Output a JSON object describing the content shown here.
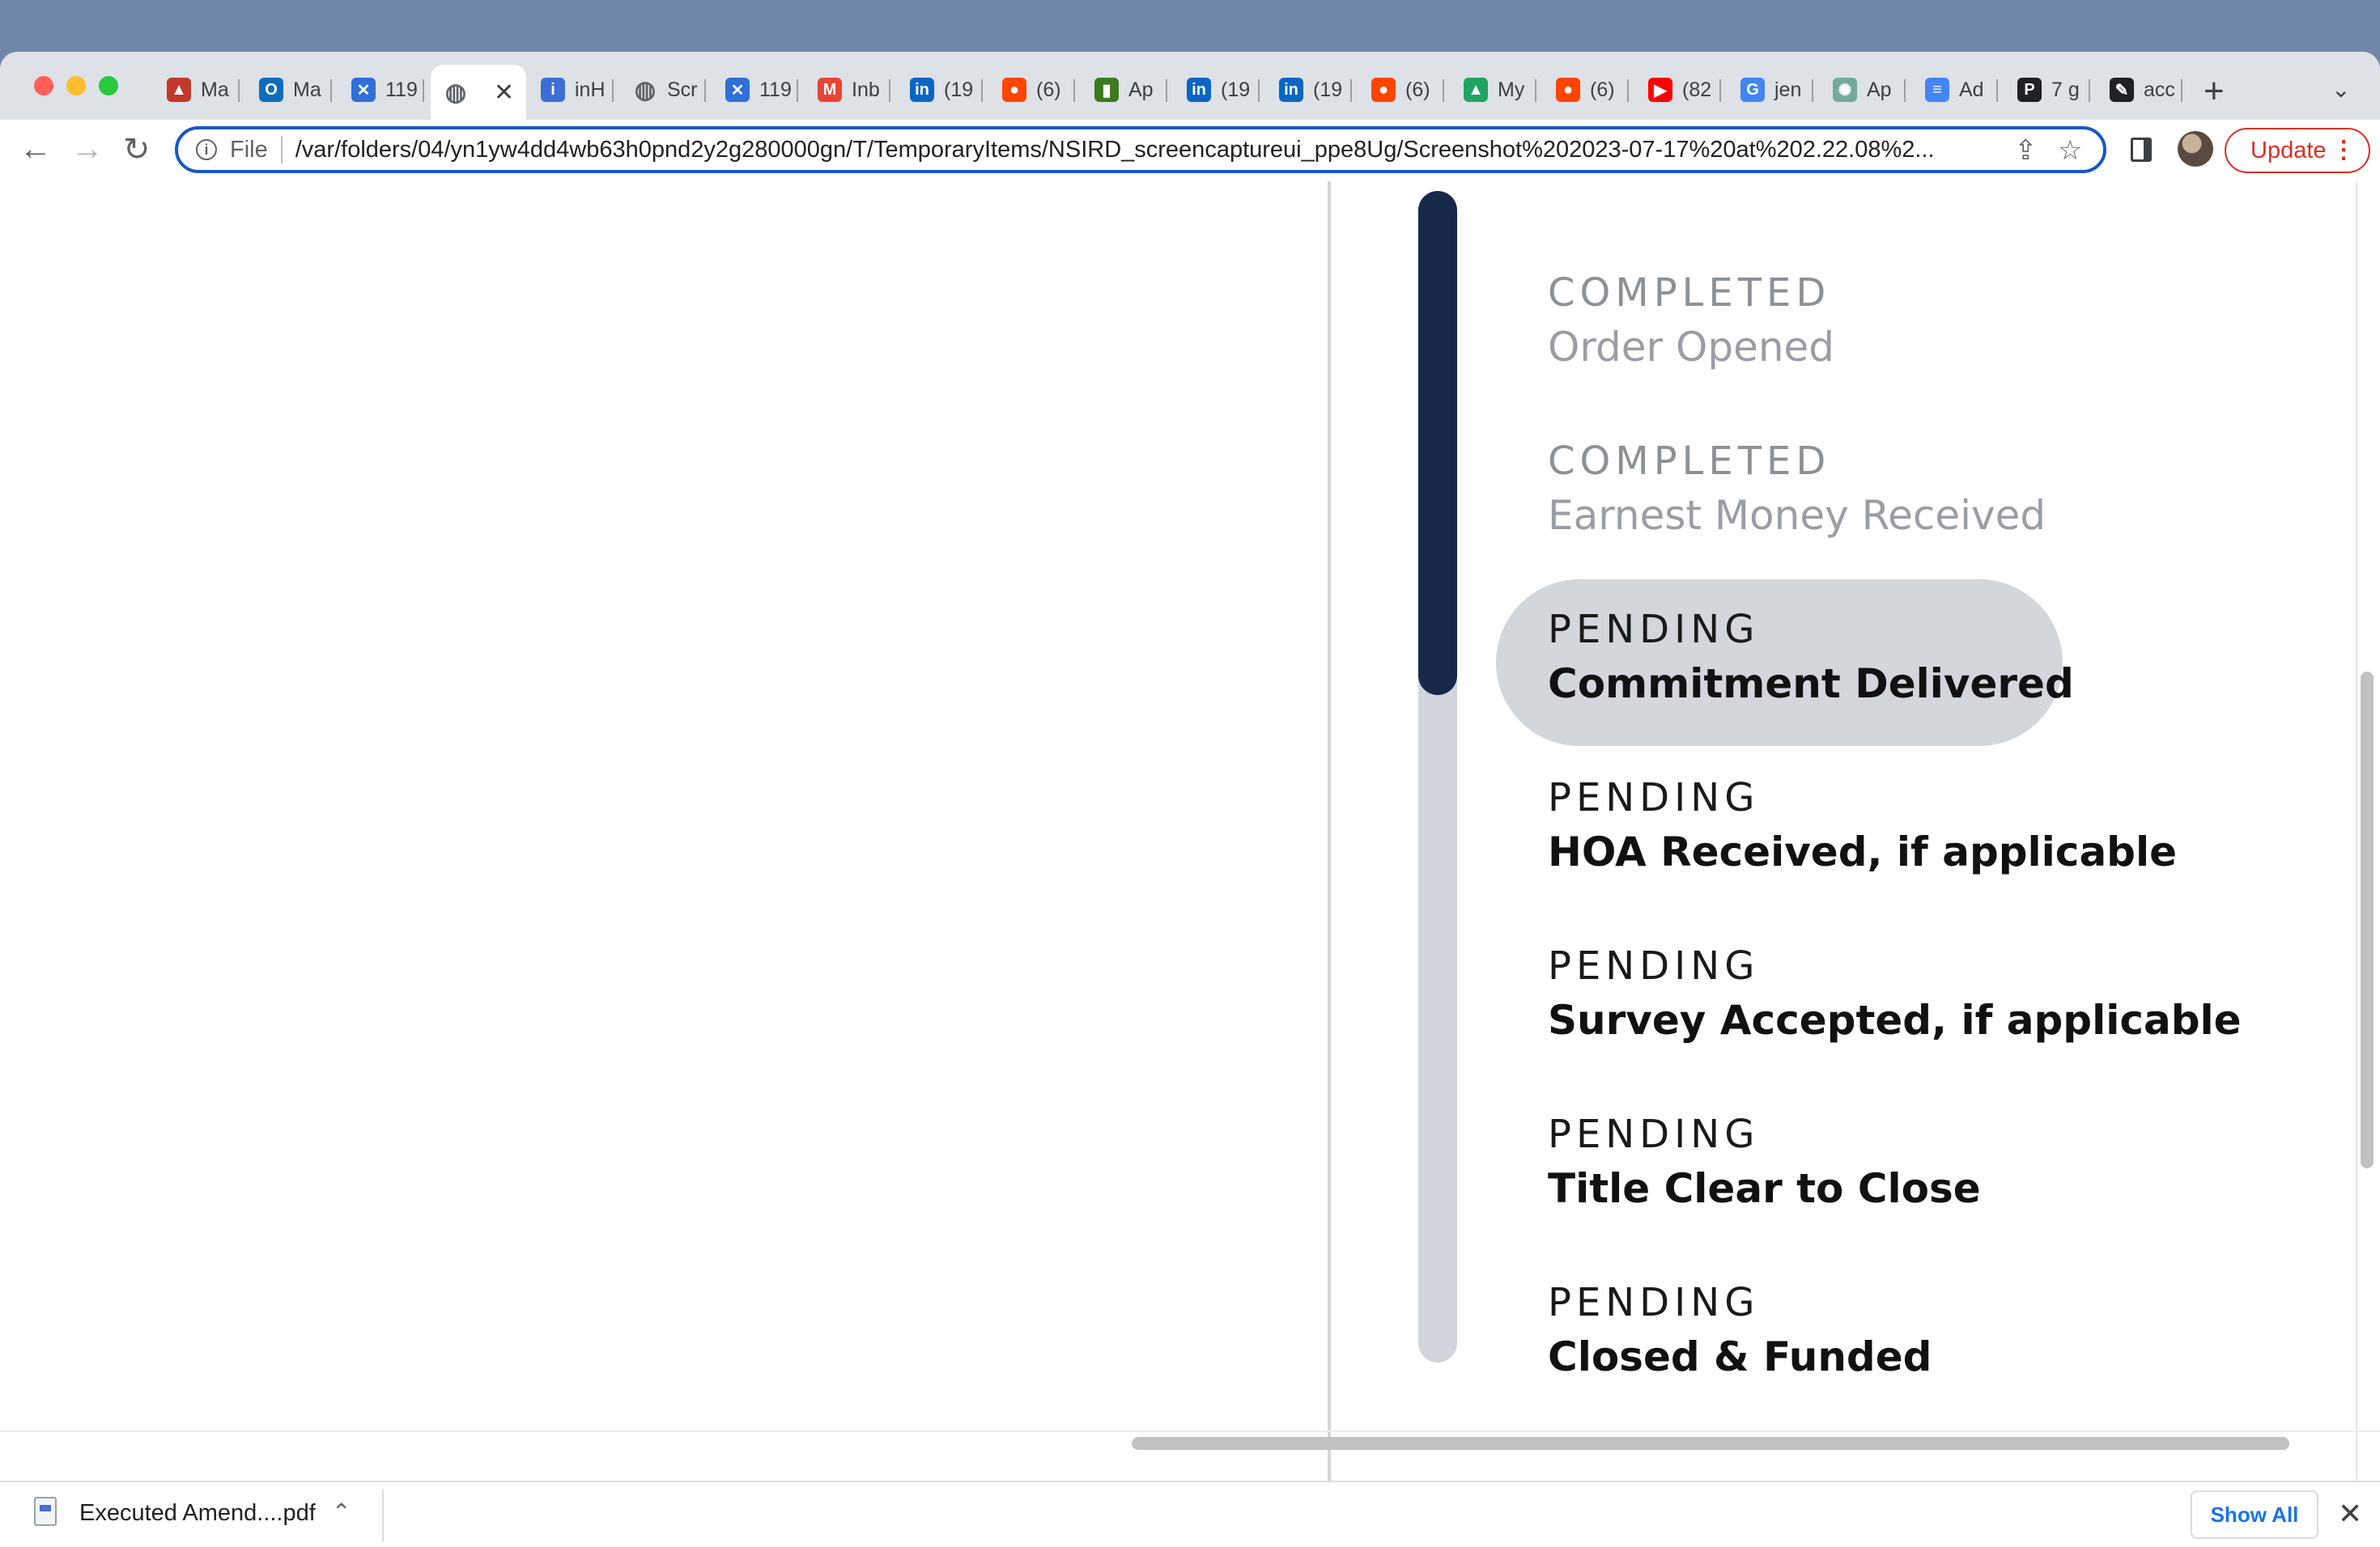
{
  "browser": {
    "tabs": [
      {
        "label": "Ma",
        "icon": "stack-icon",
        "color": "#c0392b",
        "glyph": "▲"
      },
      {
        "label": "Ma",
        "icon": "outlook-icon",
        "color": "#0f6cbd",
        "glyph": "O"
      },
      {
        "label": "119",
        "icon": "jira-icon",
        "color": "#2f6fd6",
        "glyph": "✕"
      },
      {
        "label": "",
        "icon": "globe-icon",
        "color": "#5f6368",
        "glyph": "◍",
        "active": true
      },
      {
        "label": "inH",
        "icon": "figure-icon",
        "color": "#3b6fd4",
        "glyph": "i"
      },
      {
        "label": "Scr",
        "icon": "globe-icon",
        "color": "#5f6368",
        "glyph": "◍"
      },
      {
        "label": "119",
        "icon": "jira-icon",
        "color": "#2f6fd6",
        "glyph": "✕"
      },
      {
        "label": "Inb",
        "icon": "gmail-icon",
        "color": "#ea4335",
        "glyph": "M"
      },
      {
        "label": "(19",
        "icon": "linkedin-icon",
        "color": "#0a66c2",
        "glyph": "in"
      },
      {
        "label": "(6)",
        "icon": "reddit-icon",
        "color": "#ff4500",
        "glyph": "●"
      },
      {
        "label": "Ap",
        "icon": "android-icon",
        "color": "#3c7a1e",
        "glyph": "▮"
      },
      {
        "label": "(19",
        "icon": "linkedin-icon",
        "color": "#0a66c2",
        "glyph": "in"
      },
      {
        "label": "(19",
        "icon": "linkedin-icon",
        "color": "#0a66c2",
        "glyph": "in"
      },
      {
        "label": "(6)",
        "icon": "reddit-icon",
        "color": "#ff4500",
        "glyph": "●"
      },
      {
        "label": "My",
        "icon": "drive-icon",
        "color": "#1fa463",
        "glyph": "▲"
      },
      {
        "label": "(6)",
        "icon": "reddit-icon",
        "color": "#ff4500",
        "glyph": "●"
      },
      {
        "label": "(82",
        "icon": "youtube-icon",
        "color": "#ff0000",
        "glyph": "▶"
      },
      {
        "label": "jen",
        "icon": "google-icon",
        "color": "#4285f4",
        "glyph": "G"
      },
      {
        "label": "Ap",
        "icon": "chatgpt-icon",
        "color": "#74aa9c",
        "glyph": "✺"
      },
      {
        "label": "Ad",
        "icon": "docs-icon",
        "color": "#4285f4",
        "glyph": "≡"
      },
      {
        "label": "7 g",
        "icon": "p-icon",
        "color": "#202124",
        "glyph": "P"
      },
      {
        "label": "acc",
        "icon": "pen-icon",
        "color": "#202124",
        "glyph": "✎"
      }
    ],
    "close_glyph": "✕",
    "new_tab_glyph": "+",
    "tab_menu_glyph": "⌄",
    "nav": {
      "back": "←",
      "forward": "→",
      "reload": "↻"
    },
    "address": {
      "scheme": "File",
      "url": "/var/folders/04/yn1yw4dd4wb63h0pnd2y2g280000gn/T/TemporaryItems/NSIRD_screencaptureui_ppe8Ug/Screenshot%202023-07-17%20at%202.22.08%2..."
    },
    "share_glyph": "⇪",
    "star_glyph": "☆",
    "update_label": "Update",
    "more_glyph": "⋮"
  },
  "timeline": {
    "progress_fraction": 0.43,
    "steps": [
      {
        "status": "COMPLETED",
        "title": "Order Opened",
        "state": "completed"
      },
      {
        "status": "COMPLETED",
        "title": "Earnest Money Received",
        "state": "completed"
      },
      {
        "status": "PENDING",
        "title": "Commitment Delivered",
        "state": "current"
      },
      {
        "status": "PENDING",
        "title": "HOA Received, if applicable",
        "state": "pending"
      },
      {
        "status": "PENDING",
        "title": "Survey Accepted, if applicable",
        "state": "pending"
      },
      {
        "status": "PENDING",
        "title": "Title Clear to Close",
        "state": "pending"
      },
      {
        "status": "PENDING",
        "title": "Closed & Funded",
        "state": "pending"
      }
    ]
  },
  "downloads": {
    "file_name": "Executed Amend....pdf",
    "chevron": "⌃",
    "show_all_label": "Show All",
    "close_glyph": "✕"
  }
}
